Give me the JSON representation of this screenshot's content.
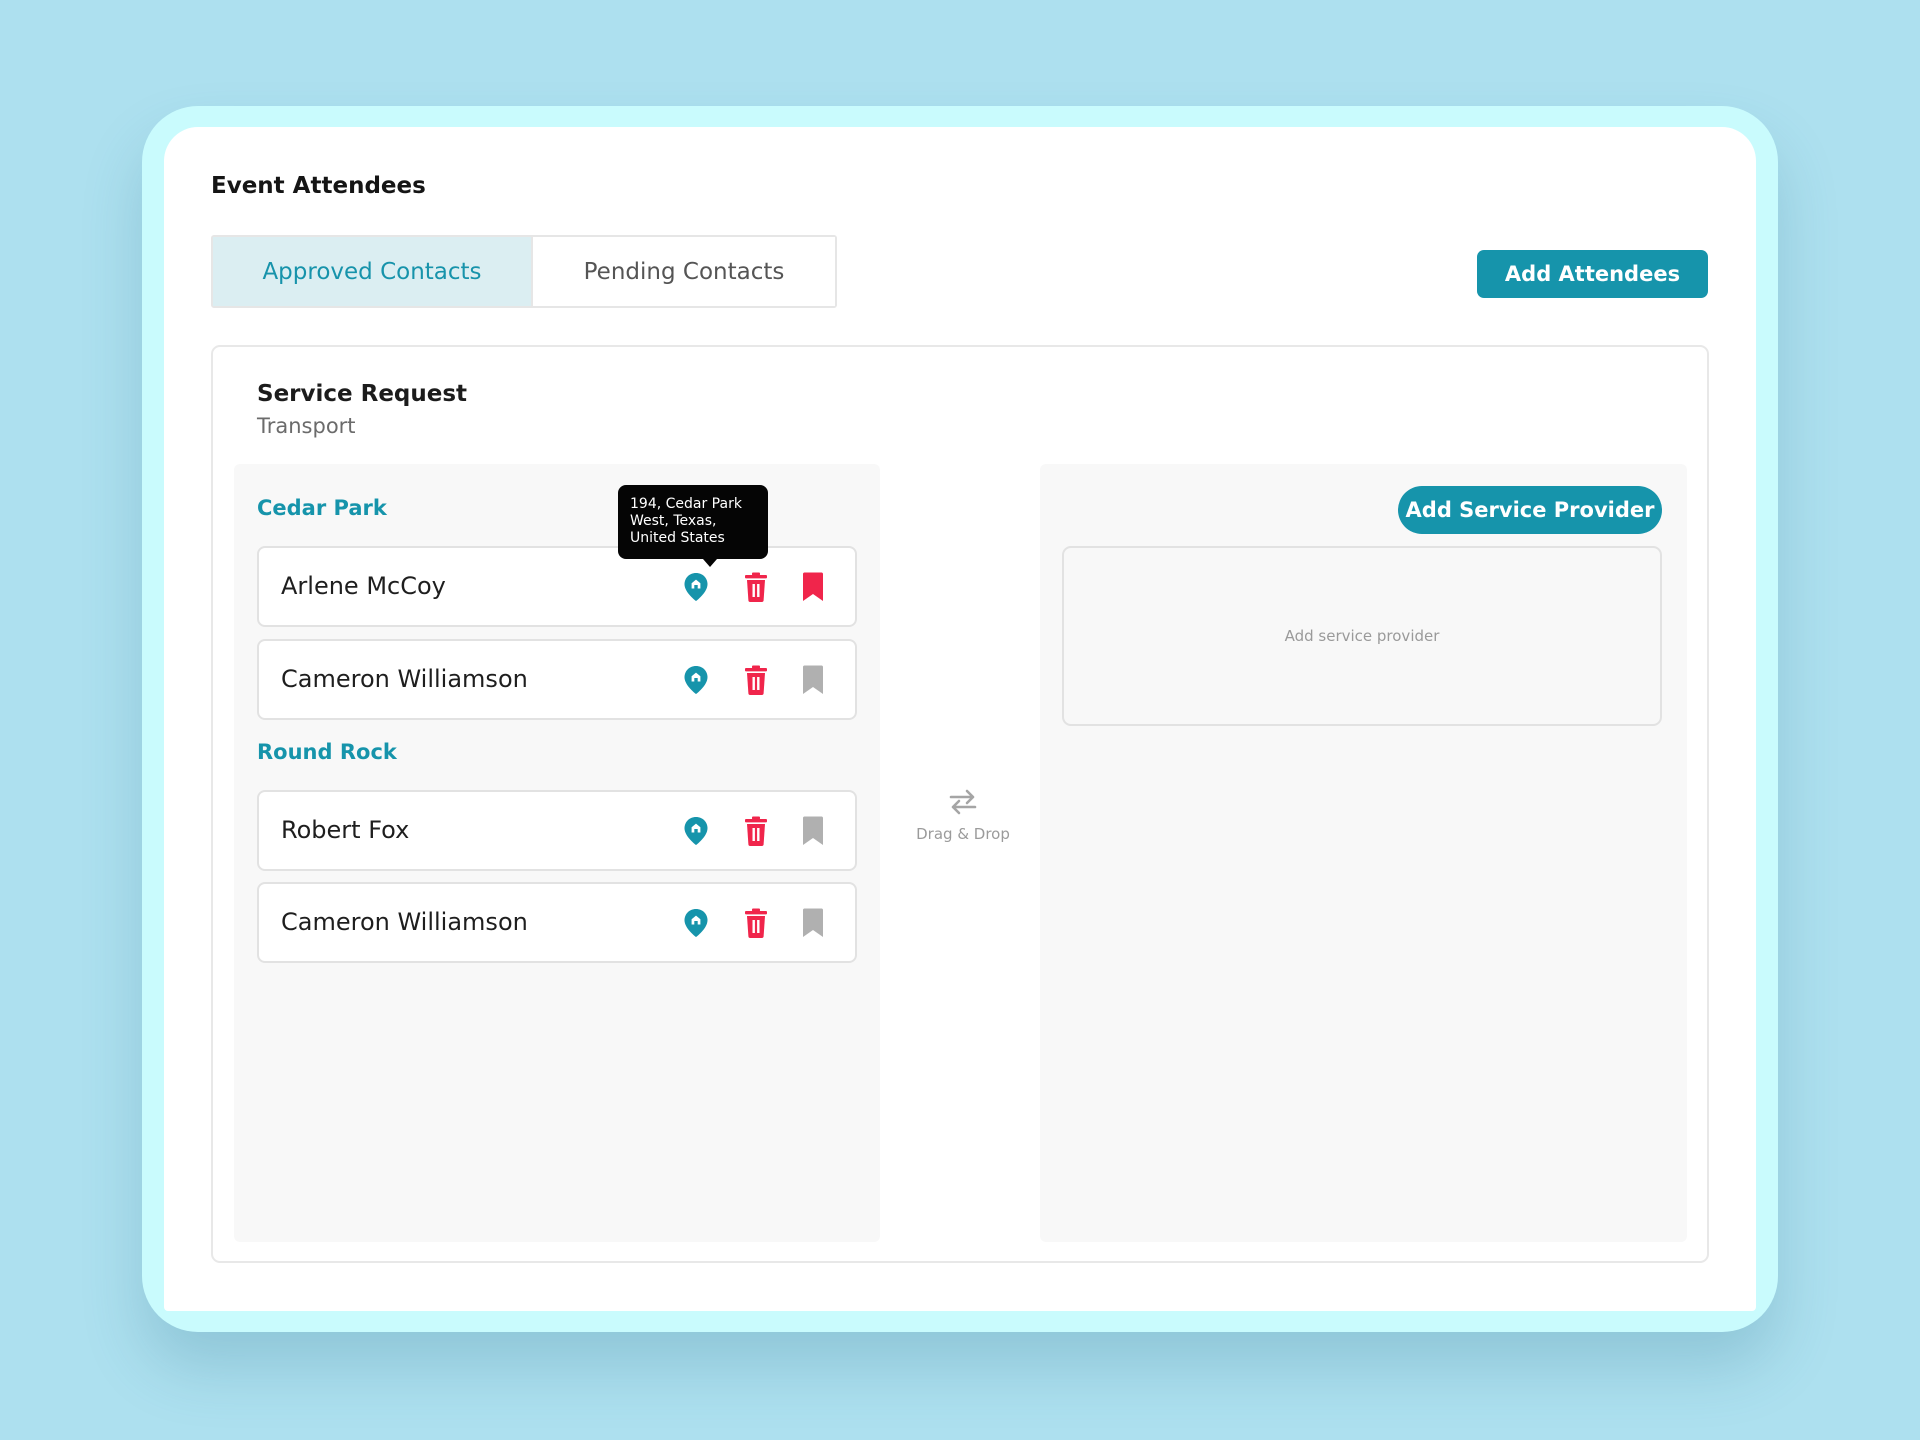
{
  "header": {
    "title": "Event Attendees",
    "add_attendees_label": "Add Attendees"
  },
  "tabs": [
    {
      "label": "Approved Contacts",
      "active": true
    },
    {
      "label": "Pending Contacts",
      "active": false
    }
  ],
  "request": {
    "title": "Service Request",
    "subtitle": "Transport"
  },
  "groups": [
    {
      "label": "Cedar Park",
      "contacts": [
        {
          "name": "Arlene McCoy",
          "bookmarked": true
        },
        {
          "name": "Cameron Williamson",
          "bookmarked": false
        }
      ]
    },
    {
      "label": "Round Rock",
      "contacts": [
        {
          "name": "Robert Fox",
          "bookmarked": false
        },
        {
          "name": "Cameron Williamson",
          "bookmarked": false
        }
      ]
    }
  ],
  "tooltip": {
    "line1": "194, Cedar Park",
    "line2": "West, Texas,",
    "line3": "United States"
  },
  "drag_drop": {
    "label": "Drag & Drop",
    "icon": "swap-arrows-icon"
  },
  "provider": {
    "add_button_label": "Add Service Provider",
    "placeholder": "Add service provider"
  },
  "icons": {
    "pin": "location-pin-icon",
    "trash": "trash-icon",
    "bookmark": "bookmark-icon"
  },
  "colors": {
    "background": "#ade0ef",
    "device_frame": "#c9fbfd",
    "accent": "#1694ab",
    "active_tab_bg": "#dbeef2",
    "danger": "#f0254b",
    "bookmark_inactive": "#b0b0b0",
    "tooltip_bg": "#050505"
  }
}
